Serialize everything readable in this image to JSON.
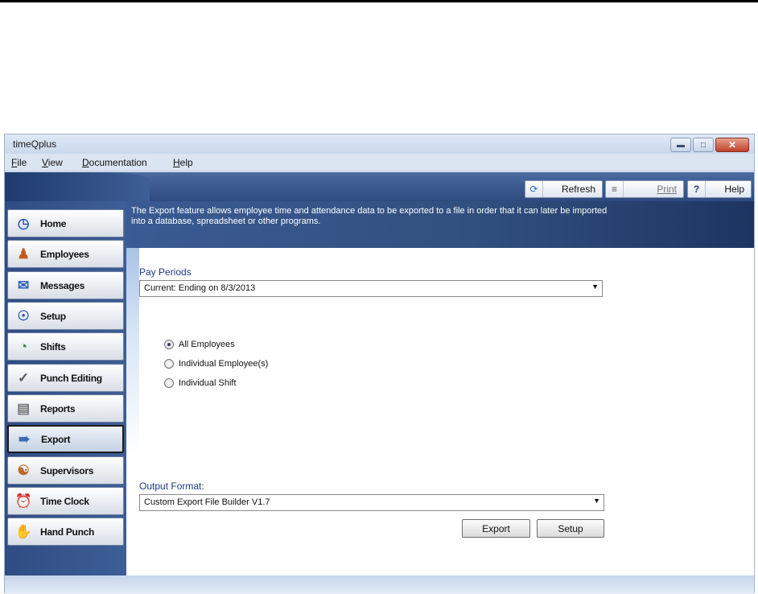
{
  "window": {
    "title": "timeQplus"
  },
  "menu": {
    "items": [
      {
        "label": "File",
        "accel": "F",
        "rest": "ile"
      },
      {
        "label": "View",
        "accel": "V",
        "rest": "iew"
      },
      {
        "label": "Documentation",
        "accel": "D",
        "rest": "ocumentation"
      },
      {
        "label": "Help",
        "accel": "H",
        "rest": "elp"
      }
    ]
  },
  "toolbar": {
    "refresh_label": "Refresh",
    "print_label": "Print",
    "help_label": "Help",
    "help_glyph": "?"
  },
  "sidebar": {
    "items": [
      {
        "label": "Home",
        "icon": "home-icon"
      },
      {
        "label": "Employees",
        "icon": "employees-icon"
      },
      {
        "label": "Messages",
        "icon": "messages-icon"
      },
      {
        "label": "Setup",
        "icon": "setup-icon"
      },
      {
        "label": "Shifts",
        "icon": "shifts-icon"
      },
      {
        "label": "Punch Editing",
        "icon": "punch-editing-icon"
      },
      {
        "label": "Reports",
        "icon": "reports-icon"
      },
      {
        "label": "Export",
        "icon": "export-icon"
      },
      {
        "label": "Supervisors",
        "icon": "supervisors-icon"
      },
      {
        "label": "Time Clock",
        "icon": "time-clock-icon"
      },
      {
        "label": "Hand Punch",
        "icon": "hand-punch-icon"
      }
    ],
    "active": "Export"
  },
  "main": {
    "description": "The Export feature allows employee time and attendance data to be exported to a file in order that it can later be imported into a database, spreadsheet or other programs.",
    "pay_periods_label": "Pay Periods",
    "pay_period_value": "Current:  Ending on 8/3/2013",
    "radios": [
      {
        "label": "All Employees",
        "checked": true
      },
      {
        "label": "Individual Employee(s)",
        "checked": false
      },
      {
        "label": "Individual Shift",
        "checked": false
      }
    ],
    "output_format_label": "Output Format:",
    "output_format_value": "Custom Export File Builder V1.7",
    "export_label": "Export",
    "setup_label": "Setup"
  },
  "colors": {
    "sidebar": "#2f4d83",
    "banner": "#3a5b93",
    "label_blue": "#1c3c7c"
  }
}
